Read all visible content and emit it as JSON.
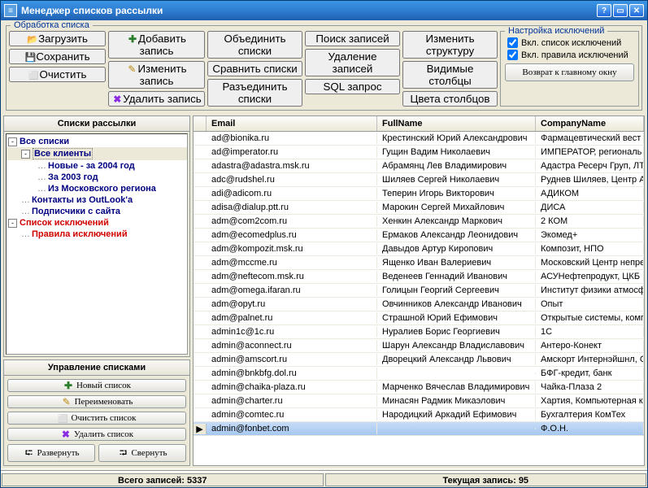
{
  "title": "Менеджер списков рассылки",
  "box_toolbar_title": "Обработка списка",
  "box_settings_title": "Настройка исключений",
  "buttons": {
    "load": "Загрузить",
    "save": "Сохранить",
    "clear": "Очистить",
    "add": "Добавить запись",
    "edit": "Изменить запись",
    "delete": "Удалить запись",
    "merge": "Объединить списки",
    "compare": "Сравнить списки",
    "split": "Разъединить списки",
    "search": "Поиск записей",
    "delrec": "Удаление записей",
    "sql": "SQL запрос",
    "struct": "Изменить структуру",
    "cols": "Видимые столбцы",
    "colors": "Цвета столбцов",
    "back": "Возврат к главному окну"
  },
  "checks": {
    "excl_list": "Вкл. список исключений",
    "excl_rules": "Вкл. правила исключений"
  },
  "tree_header": "Списки рассылки",
  "tree": [
    {
      "depth": 0,
      "exp": "-",
      "label": "Все списки",
      "cls": "blue"
    },
    {
      "depth": 1,
      "exp": "-",
      "label": "Все клиенты",
      "cls": "blue",
      "sel": true
    },
    {
      "depth": 2,
      "exp": "",
      "label": "Новые - за 2004 год",
      "cls": "blue"
    },
    {
      "depth": 2,
      "exp": "",
      "label": "За 2003 год",
      "cls": "blue"
    },
    {
      "depth": 2,
      "exp": "",
      "label": "Из Московского региона",
      "cls": "blue"
    },
    {
      "depth": 1,
      "exp": "",
      "label": "Контакты из OutLook'а",
      "cls": "blue"
    },
    {
      "depth": 1,
      "exp": "",
      "label": "Подписчики с сайта",
      "cls": "blue"
    },
    {
      "depth": 0,
      "exp": "-",
      "label": "Список исключений",
      "cls": "red"
    },
    {
      "depth": 1,
      "exp": "",
      "label": "Правила исключений",
      "cls": "red"
    }
  ],
  "manage_header": "Управление списками",
  "manage": {
    "new": "Новый список",
    "rename": "Переименовать",
    "clear": "Очистить список",
    "delete": "Удалить список",
    "expand": "Развернуть",
    "collapse": "Свернуть"
  },
  "grid_headers": {
    "c1": "Email",
    "c2": "FullName",
    "c3": "CompanyName"
  },
  "rows": [
    {
      "email": "ad@bionika.ru",
      "name": "Крестинский Юрий Александрович",
      "co": "Фармацевтический вест"
    },
    {
      "email": "ad@imperator.ru",
      "name": "Гущин Вадим Николаевич",
      "co": "ИМПЕРАТОР, региональ"
    },
    {
      "email": "adastra@adastra.msk.ru",
      "name": "Абрамянц Лев Владимирович",
      "co": "Адастра Ресерч Груп, ЛТ"
    },
    {
      "email": "adc@rudshel.ru",
      "name": "Шиляев Сергей Николаевич",
      "co": "Руднев Шиляев, Центр А"
    },
    {
      "email": "adi@adicom.ru",
      "name": "Теперин Игорь Викторович",
      "co": "АДИКОМ"
    },
    {
      "email": "adisa@dialup.ptt.ru",
      "name": "Марокин Сергей Михайлович",
      "co": "ДИСА"
    },
    {
      "email": "adm@com2com.ru",
      "name": "Хенкин Александр Маркович",
      "co": "2 КОМ"
    },
    {
      "email": "adm@ecomedplus.ru",
      "name": "Ермаков Александр Леонидович",
      "co": "Экомед+"
    },
    {
      "email": "adm@kompozit.msk.ru",
      "name": "Давыдов Артур Киропович",
      "co": "Композит, НПО"
    },
    {
      "email": "adm@mccme.ru",
      "name": "Ященко Иван Валериевич",
      "co": "Московский Центр непре"
    },
    {
      "email": "adm@neftecom.msk.ru",
      "name": "Веденеев Геннадий Иванович",
      "co": "АСУНефтепродукт, ЦКБ"
    },
    {
      "email": "adm@omega.ifaran.ru",
      "name": "Голицын Георгий Сергеевич",
      "co": "Институт физики атмосф"
    },
    {
      "email": "adm@opyt.ru",
      "name": "Овчинников Александр Иванович",
      "co": "Опыт"
    },
    {
      "email": "adm@palnet.ru",
      "name": "Страшной Юрий Ефимович",
      "co": "Открытые системы, комп"
    },
    {
      "email": "admin1c@1c.ru",
      "name": "Нуралиев Борис Георгиевич",
      "co": "1С"
    },
    {
      "email": "admin@aconnect.ru",
      "name": "Шарун Александр Владиславович",
      "co": "Антеро-Конект"
    },
    {
      "email": "admin@amscort.ru",
      "name": "Дворецкий Александр Львович",
      "co": "Амскорт Интернэйшнл, С"
    },
    {
      "email": "admin@bnkbfg.dol.ru",
      "name": "",
      "co": "БФГ-кредит, банк"
    },
    {
      "email": "admin@chaika-plaza.ru",
      "name": "Марченко Вячеслав Владимирович",
      "co": "Чайка-Плаза 2"
    },
    {
      "email": "admin@charter.ru",
      "name": "Минасян Радмик Микаэлович",
      "co": "Хартия, Компьютерная к"
    },
    {
      "email": "admin@comtec.ru",
      "name": "Народицкий Аркадий Ефимович",
      "co": "Бухгалтерия КомТех"
    },
    {
      "email": "admin@fonbet.com",
      "name": "",
      "co": "Ф.О.Н.",
      "sel": true
    }
  ],
  "status": {
    "total_label": "Всего записей:",
    "total_value": "5337",
    "current_label": "Текущая запись:",
    "current_value": "95"
  }
}
